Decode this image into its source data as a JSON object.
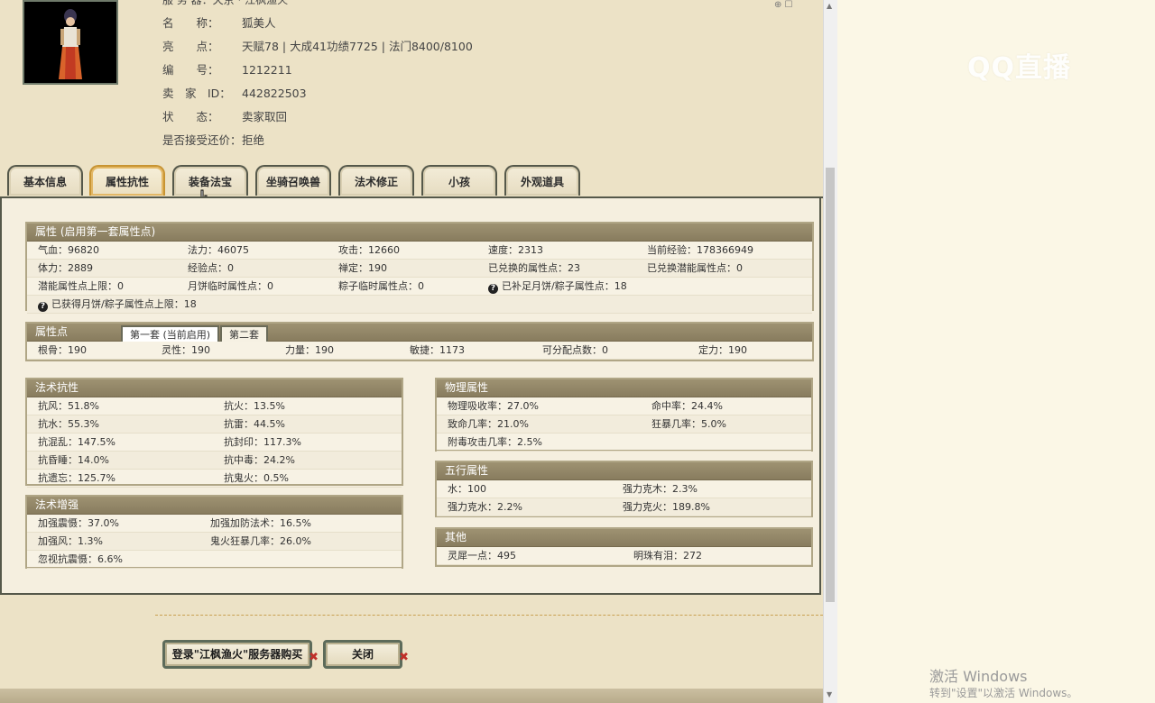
{
  "info": {
    "server_partial": "服 务 器：天京 · 江枫渔火",
    "rows": [
      {
        "label": "名　　称：",
        "value": "狐美人"
      },
      {
        "label": "亮　　点：",
        "value": "天赋78 | 大成41功绩7725 | 法门8400/8100"
      },
      {
        "label": "编　　号：",
        "value": "1212211"
      },
      {
        "label": "卖　家　ID：",
        "value": "442822503"
      },
      {
        "label": "状　　态：",
        "value": "卖家取回"
      },
      {
        "label": "是否接受还价：",
        "value": "拒绝"
      }
    ]
  },
  "tabs": [
    "基本信息",
    "属性抗性",
    "装备法宝",
    "坐骑召唤兽",
    "法术修正",
    "小孩",
    "外观道具"
  ],
  "attr_panel": {
    "title": "属性 (启用第一套属性点)",
    "rows": [
      [
        "气血：96820",
        "法力：46075",
        "攻击：12660",
        "速度：2313",
        "当前经验：178366949"
      ],
      [
        "体力：2889",
        "经验点：0",
        "禅定：190",
        "已兑换的属性点：23",
        "已兑换潜能属性点：0"
      ],
      [
        "潜能属性点上限：0",
        "月饼临时属性点：0",
        "粽子临时属性点：0",
        "已补足月饼/粽子属性点：18",
        ""
      ]
    ],
    "last_row": "已获得月饼/粽子属性点上限：18"
  },
  "points_panel": {
    "title": "属性点",
    "subtabs": [
      "第一套 (当前启用)",
      "第二套"
    ],
    "row": [
      "根骨：190",
      "灵性：190",
      "力量：190",
      "敏捷：1173",
      "可分配点数：0",
      "定力：190"
    ]
  },
  "resist_panel": {
    "title": "法术抗性",
    "rows": [
      [
        "抗风：51.8%",
        "抗火：13.5%"
      ],
      [
        "抗水：55.3%",
        "抗雷：44.5%"
      ],
      [
        "抗混乱：147.5%",
        "抗封印：117.3%"
      ],
      [
        "抗昏睡：14.0%",
        "抗中毒：24.2%"
      ],
      [
        "抗遗忘：125.7%",
        "抗鬼火：0.5%"
      ]
    ]
  },
  "enhance_panel": {
    "title": "法术增强",
    "rows": [
      [
        "加强震慑：37.0%",
        "加强加防法术：16.5%"
      ],
      [
        "加强风：1.3%",
        "鬼火狂暴几率：26.0%"
      ],
      [
        "忽视抗震慑：6.6%",
        ""
      ]
    ]
  },
  "phys_panel": {
    "title": "物理属性",
    "rows": [
      [
        "物理吸收率：27.0%",
        "命中率：24.4%"
      ],
      [
        "致命几率：21.0%",
        "狂暴几率：5.0%"
      ],
      [
        "附毒攻击几率：2.5%",
        ""
      ]
    ]
  },
  "five_panel": {
    "title": "五行属性",
    "rows": [
      [
        "水：100",
        "强力克木：2.3%"
      ],
      [
        "强力克水：2.2%",
        "强力克火：189.8%"
      ]
    ]
  },
  "other_panel": {
    "title": "其他",
    "rows": [
      [
        "灵犀一点：495",
        "明珠有泪：272"
      ]
    ]
  },
  "buttons": {
    "login": "登录\"江枫渔火\"服务器购买",
    "close": "关闭"
  },
  "overlay": {
    "logo": "QQ直播",
    "win_title": "激活 Windows",
    "win_sub": "转到\"设置\"以激活 Windows。"
  }
}
